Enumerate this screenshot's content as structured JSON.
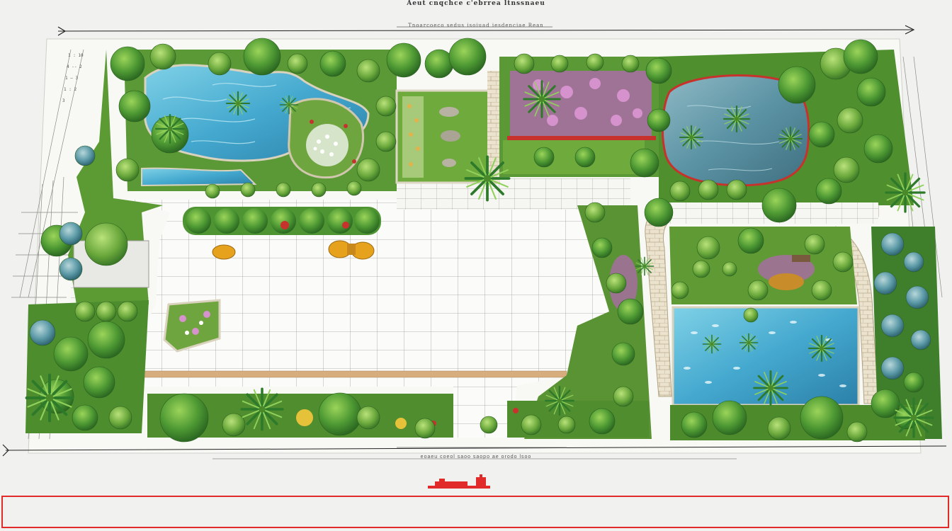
{
  "drawing": {
    "title_line_1": "Aeut cnqchce c'ebrrea ltnssnaeu",
    "title_line_2": "Tnoarcoeco sedus isoiuad iesdenciae Rean",
    "scale_caption": "eoaeu coeol saoo saopo ae orodo lsoo"
  },
  "palette": {
    "paper": "#f7f7f4",
    "paving": "#fafaf8",
    "paving_line": "#a7a7a2",
    "water": "#4eb5d6",
    "water_dark": "#2b7fa5",
    "lawn": "#6ea83a",
    "shrub": "#3f8a2e",
    "flower_pink": "#c170b8",
    "flower_red": "#c8322c",
    "flower_white": "#f1f1ea",
    "stone_path": "#e7ddc8",
    "deck_wood": "#d9b48a",
    "accent_red": "#e12a2a",
    "furniture": "#e6a11d"
  },
  "plan_elements": [
    "pond-northwest",
    "pond-northeast",
    "pond-southeast",
    "central-paved-plaza",
    "herb-garden-bed",
    "flower-meadow",
    "sitting-area",
    "curved-stone-path",
    "planting-border-south",
    "planting-border-west",
    "planting-border-east"
  ],
  "icons": {
    "palm": "palm-plant-icon",
    "shrub": "shrub-icon",
    "tree": "tree-icon",
    "lounge_chair": "lounge-chair-icon"
  }
}
